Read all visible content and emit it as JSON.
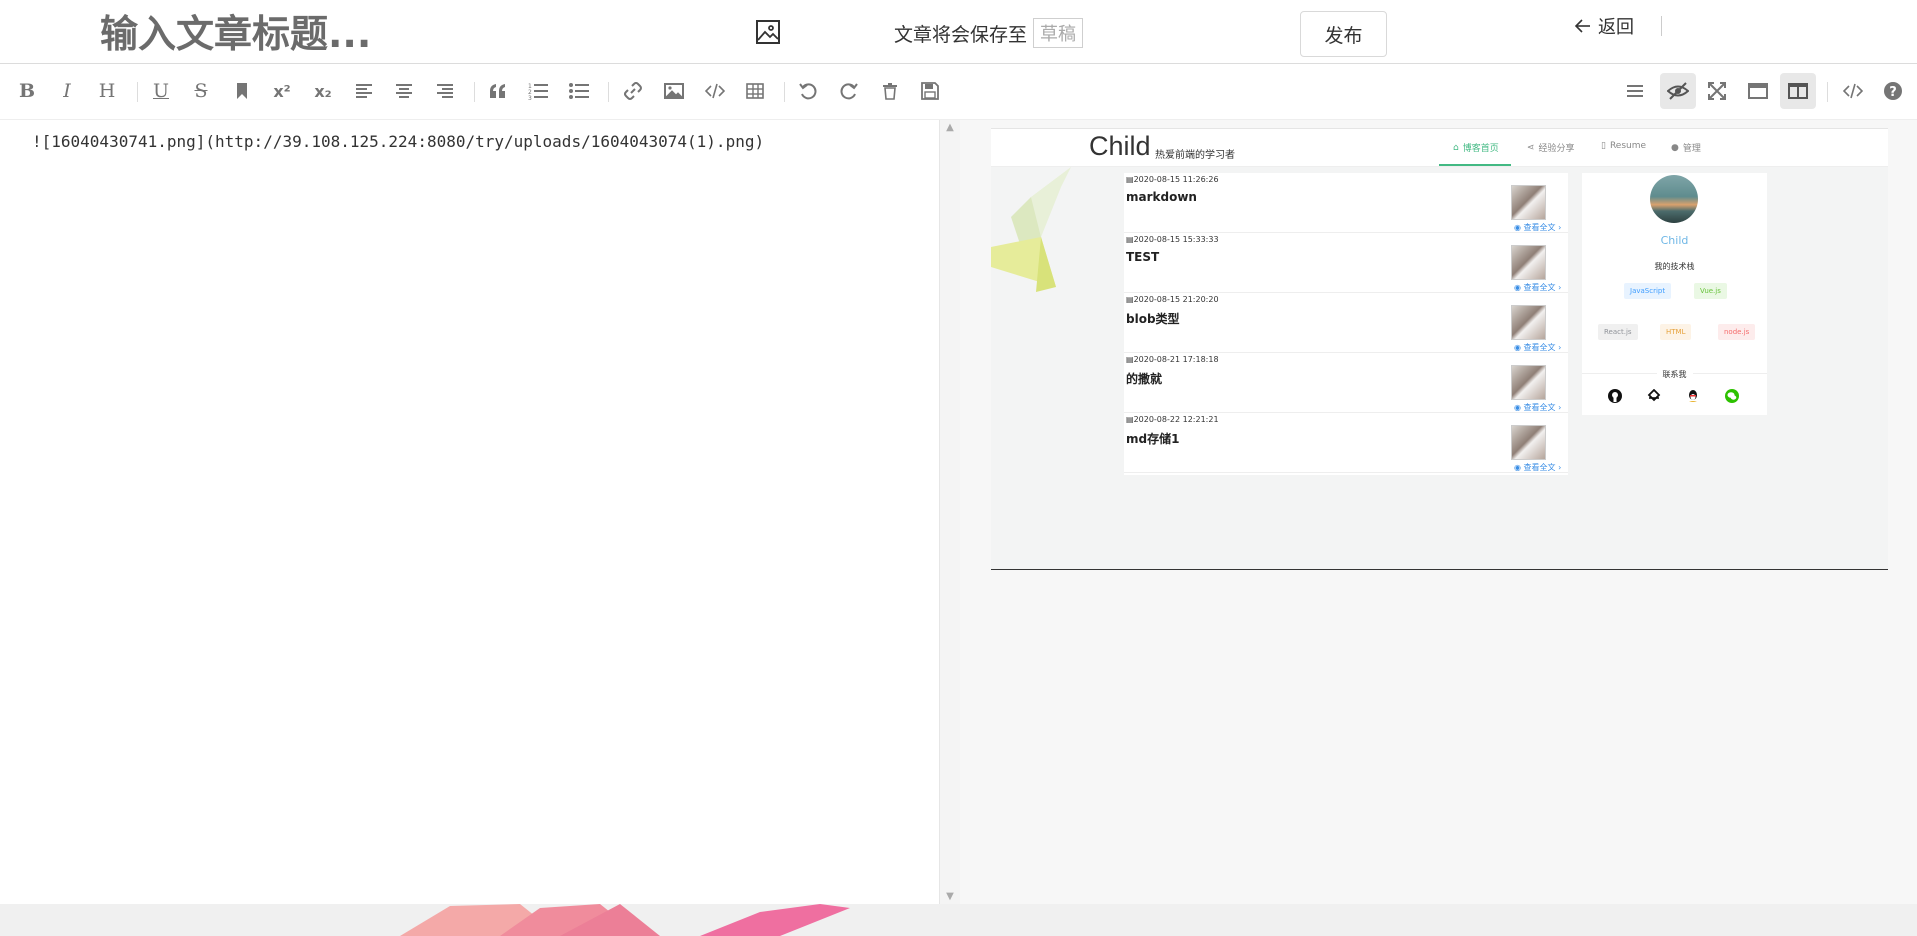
{
  "header": {
    "title_placeholder": "输入文章标题...",
    "cover_icon": "image-icon",
    "save_note": "文章将会保存至",
    "draft_label": "草稿",
    "publish_label": "发布",
    "back_label": "返回"
  },
  "toolbar": {
    "left_items": [
      "bold",
      "italic",
      "header",
      "underline",
      "strikethrough",
      "mark",
      "superscript",
      "subscript",
      "align-left",
      "align-center",
      "align-right",
      "quote",
      "ordered-list",
      "unordered-list",
      "link",
      "image",
      "code",
      "table",
      "undo",
      "redo",
      "trash",
      "save"
    ],
    "right_items": [
      "navigation",
      "preview-toggle",
      "fullscreen",
      "read-mode",
      "subfield",
      "html-code",
      "help"
    ],
    "glyphs": {
      "bold": "B",
      "italic": "I",
      "header": "H",
      "underline": "U",
      "strikethrough": "S",
      "superscript": "x²",
      "subscript": "x₂"
    }
  },
  "editor": {
    "content": "![16040430741.png](http://39.108.125.224:8080/try/uploads/1604043074(1).png)"
  },
  "preview": {
    "blog": {
      "brand": "Child",
      "tagline": "热爱前端的学习者",
      "tabs": [
        "博客首页",
        "经验分享",
        "Resume",
        "管理"
      ],
      "active_tab": 0,
      "posts": [
        {
          "date": "2020-08-15 11:26:26",
          "title": "markdown",
          "read_more": "查看全文"
        },
        {
          "date": "2020-08-15 15:33:33",
          "title": "TEST",
          "read_more": "查看全文"
        },
        {
          "date": "2020-08-15 21:20:20",
          "title": "blob类型",
          "read_more": "查看全文"
        },
        {
          "date": "2020-08-21 17:18:18",
          "title": "的撒就",
          "read_more": "查看全文"
        },
        {
          "date": "2020-08-22 12:21:21",
          "title": "md存储1",
          "read_more": "查看全文"
        }
      ],
      "profile": {
        "name": "Child",
        "stack_label": "我的技术栈",
        "tags": [
          {
            "label": "JavaScript",
            "bg": "#e8f3ff",
            "fg": "#409eff"
          },
          {
            "label": "Vue.js",
            "bg": "#eaf8e4",
            "fg": "#67c23a"
          },
          {
            "label": "React.js",
            "bg": "#f0f0f0",
            "fg": "#909399"
          },
          {
            "label": "HTML",
            "bg": "#fdf3e6",
            "fg": "#e6a23c"
          },
          {
            "label": "node.js",
            "bg": "#fdecec",
            "fg": "#f56c6c"
          }
        ],
        "contact_label": "联系我",
        "social_icons": [
          "github-icon",
          "juejin-icon",
          "qq-icon",
          "wechat-icon"
        ]
      }
    }
  },
  "colors": {
    "accent": "#42b983",
    "link": "#3a8ee6"
  }
}
